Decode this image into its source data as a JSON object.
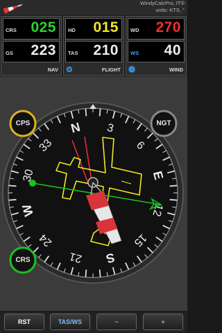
{
  "header": {
    "title": "WindyCalcPro, IT®",
    "units": "units: KTS, °"
  },
  "panels": {
    "nav": {
      "title": "NAV",
      "rows": [
        {
          "label": "CRS",
          "value": "025",
          "color": "#2bd42b"
        },
        {
          "label": "GS",
          "value": "223",
          "color": "#eeeeee"
        }
      ]
    },
    "flight": {
      "title": "FLIGHT",
      "rows": [
        {
          "label": "HD",
          "value": "015",
          "color": "#f4e825"
        },
        {
          "label": "TAS",
          "value": "210",
          "color": "#eeeeee"
        }
      ]
    },
    "wind": {
      "title": "WIND",
      "rows": [
        {
          "label": "WD",
          "value": "270",
          "color": "#ee3030"
        },
        {
          "label": "WS",
          "value": "40",
          "color": "#eeeeee"
        }
      ]
    }
  },
  "compass": {
    "cardinals": [
      "N",
      "E",
      "S",
      "W"
    ],
    "numbers": [
      "3",
      "6",
      "12",
      "15",
      "21",
      "24",
      "30",
      "33"
    ],
    "cps_label": "CPS",
    "ngt_label": "NGT",
    "crs_label": "CRS",
    "heading": 15,
    "course": 25,
    "wind_dir": 270
  },
  "buttons": {
    "rst": "RST",
    "tasws": "TAS/WS",
    "minus": "−",
    "plus": "+"
  },
  "colors": {
    "course": "#19c21f",
    "heading": "#f4e825",
    "wind": "#ee3030",
    "cps_ring": "#e0b21c",
    "crs_ring": "#19c21f",
    "ngt_ring": "#888888"
  }
}
